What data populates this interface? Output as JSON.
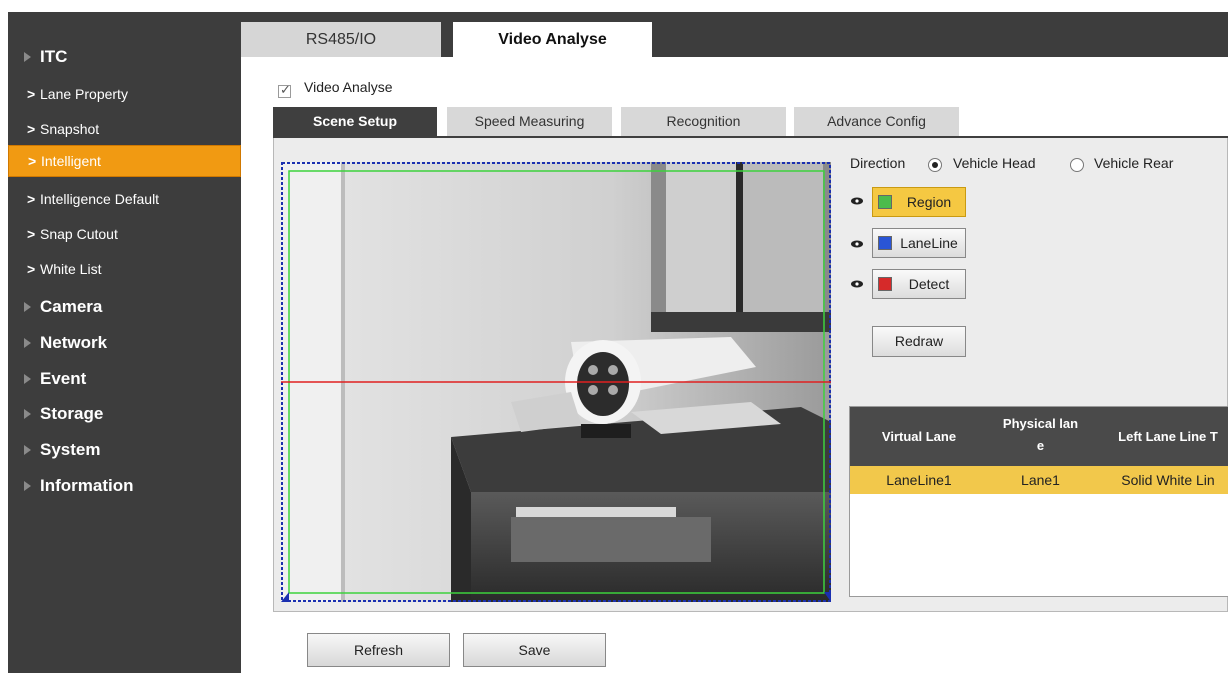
{
  "sidebar": {
    "items": [
      {
        "label": "ITC",
        "kind": "main"
      },
      {
        "label": "Lane Property",
        "kind": "sub"
      },
      {
        "label": "Snapshot",
        "kind": "sub"
      },
      {
        "label": "Intelligent",
        "kind": "sub",
        "active": true
      },
      {
        "label": "Intelligence Default",
        "kind": "sub"
      },
      {
        "label": "Snap Cutout",
        "kind": "sub"
      },
      {
        "label": "White List",
        "kind": "sub"
      },
      {
        "label": "Camera",
        "kind": "main"
      },
      {
        "label": "Network",
        "kind": "main"
      },
      {
        "label": "Event",
        "kind": "main"
      },
      {
        "label": "Storage",
        "kind": "main"
      },
      {
        "label": "System",
        "kind": "main"
      },
      {
        "label": "Information",
        "kind": "main"
      }
    ]
  },
  "top_tabs": [
    {
      "label": "RS485/IO",
      "active": false
    },
    {
      "label": "Video Analyse",
      "active": true
    }
  ],
  "video_analyse_checkbox": {
    "label": "Video Analyse",
    "checked": true
  },
  "sub_tabs": [
    {
      "label": "Scene Setup",
      "active": true
    },
    {
      "label": "Speed Measuring",
      "active": false
    },
    {
      "label": "Recognition",
      "active": false
    },
    {
      "label": "Advance Config",
      "active": false
    }
  ],
  "direction": {
    "label": "Direction",
    "options": [
      {
        "label": "Vehicle Head",
        "selected": true
      },
      {
        "label": "Vehicle Rear",
        "selected": false
      }
    ]
  },
  "layers": [
    {
      "label": "Region",
      "color": "#4cbb4c",
      "selected": true
    },
    {
      "label": "LaneLine",
      "color": "#2a55d6",
      "selected": false
    },
    {
      "label": "Detect",
      "color": "#d62a2a",
      "selected": false
    }
  ],
  "redraw_label": "Redraw",
  "lane_table": {
    "headers": [
      "Virtual Lane",
      "Physical lan\ne",
      "Left Lane Line T"
    ],
    "rows": [
      [
        "LaneLine1",
        "Lane1",
        "Solid White Lin"
      ]
    ]
  },
  "buttons": {
    "refresh": "Refresh",
    "save": "Save"
  },
  "colors": {
    "accent_active": "#f19a12",
    "row_highlight": "#f2c84b",
    "sidebar_bg": "#3d3d3d"
  }
}
